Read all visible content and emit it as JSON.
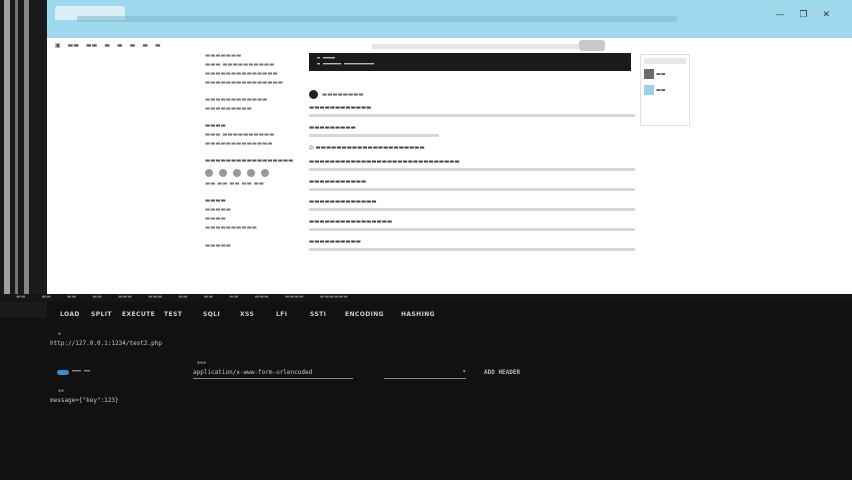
{
  "toolbar": {
    "items": [
      "LOAD",
      "SPLIT",
      "EXECUTE",
      "TEST",
      "SQLI",
      "XSS",
      "LFI",
      "SSTI",
      "ENCODING",
      "HASHING"
    ]
  },
  "request": {
    "url": "http://127.0.0.1:1234/test2.php",
    "content_type": "application/x-www-form-urlencoded",
    "add_header": "ADD HEADER",
    "body": "message={\"key\":123}"
  },
  "colors": {
    "browser_bar": "#9ed8ec",
    "devtools_bg": "#111111",
    "toggle": "#3a8bd0"
  }
}
